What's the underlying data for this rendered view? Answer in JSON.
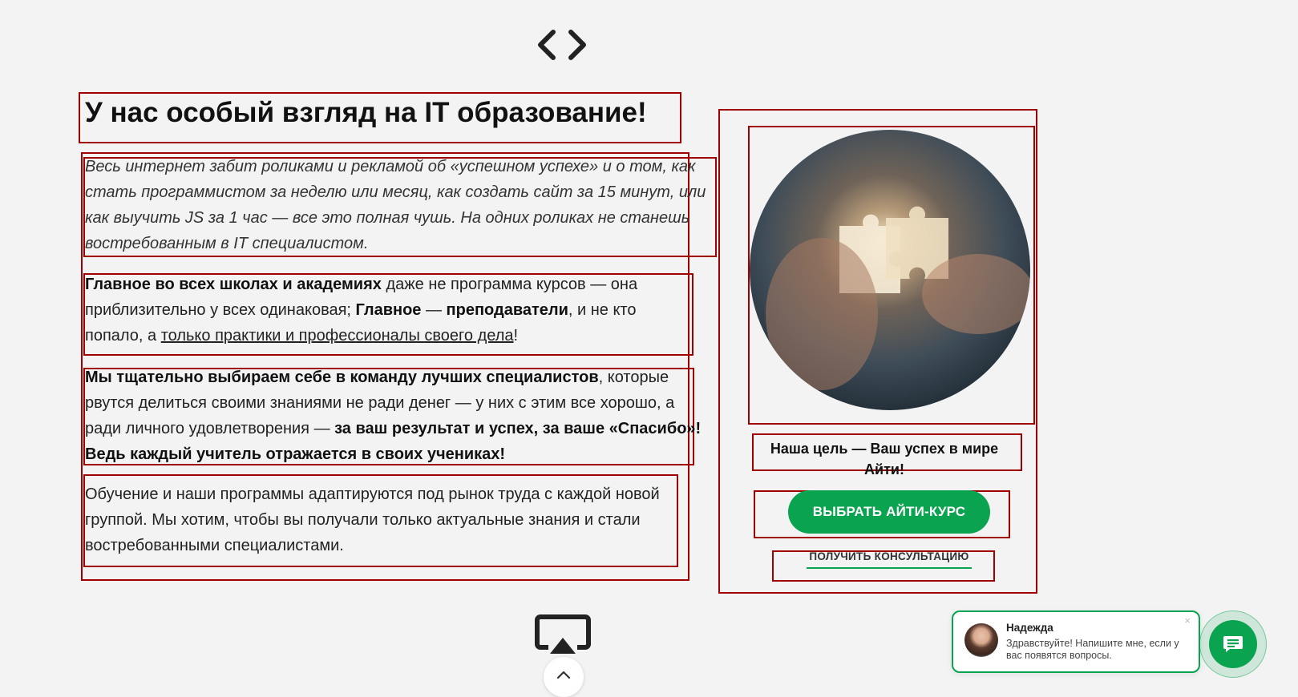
{
  "heading": "У нас особый взгляд на IT образование!",
  "paragraph1": "Весь интернет забит роликами и рекламой об «успешном успехе» и о том, как стать программистом за неделю или месяц, как создать сайт за 15 минут, или как выучить JS за 1 час — все это полная чушь. На одних роликах не станешь востребованным в IT специалистом.",
  "paragraph2": {
    "bold1": "Главное во всех школах и академиях",
    "text1": " даже не программа курсов — она приблизительно у всех одинаковая; ",
    "bold2": "Главное",
    "text2": " — ",
    "bold3": "преподаватели",
    "text3": ", и не кто попало, а ",
    "underlined": "только практики и профессионалы своего дела",
    "text4": "!"
  },
  "paragraph3": {
    "bold1": "Мы тщательно выбираем себе в команду лучших специалистов",
    "text1": ", которые рвутся делиться своими знаниями не ради денег — у них с этим все хорошо, а ради личного удовлетворения — ",
    "bold2": "за ваш результат и успех, за ваше «Спасибо»! Ведь каждый учитель отражается в своих учениках!"
  },
  "paragraph4": "Обучение и наши программы адаптируются под рынок труда с каждой новой группой. Мы хотим, чтобы вы получали только актуальные знания и стали востребованными специалистами.",
  "card": {
    "image_icon": "puzzle-hands-photo",
    "goal_text": "Наша цель — Ваш успех в мире Айти!",
    "primary_button": "ВЫБРАТЬ АЙТИ-КУРС",
    "secondary_link": "ПОЛУЧИТЬ КОНСУЛЬТАЦИЮ"
  },
  "icons": {
    "top": "code-brackets-icon",
    "bottom": "screen-cast-icon",
    "scroll": "chevron-up-icon",
    "chat": "chat-message-icon"
  },
  "chat": {
    "name": "Надежда",
    "message": "Здравствуйте! Напишите мне, если у вас появятся вопросы.",
    "close": "×"
  },
  "colors": {
    "accent": "#0aa34f",
    "background": "#f3f3f4",
    "annotation_box": "#a00000"
  }
}
